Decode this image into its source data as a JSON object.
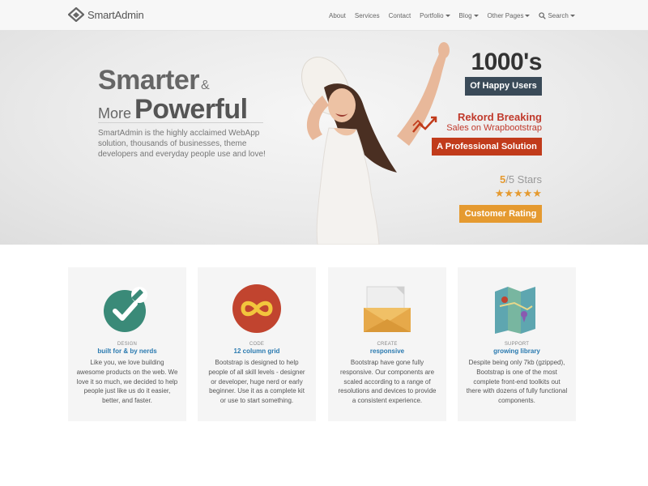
{
  "brand": {
    "name": "SmartAdmin"
  },
  "nav": [
    {
      "label": "About",
      "dropdown": false
    },
    {
      "label": "Services",
      "dropdown": false
    },
    {
      "label": "Contact",
      "dropdown": false
    },
    {
      "label": "Portfolio",
      "dropdown": true
    },
    {
      "label": "Blog",
      "dropdown": true
    },
    {
      "label": "Other Pages",
      "dropdown": true
    },
    {
      "label": "Search",
      "dropdown": true,
      "icon": "search-icon"
    }
  ],
  "hero": {
    "title_word1": "Smarter",
    "title_amp": "&",
    "title_more": "More",
    "title_word2": "Powerful",
    "description": "SmartAdmin is the highly acclaimed WebApp solution, thousands of businesses, theme developers and everyday people use and love!",
    "stat_number": "1000's",
    "stat_badge": "Of Happy Users",
    "trend_icon": "line-chart-icon",
    "rekord_title": "Rekord Breaking",
    "rekord_sub": "Sales on Wrapbootstrap",
    "pro_badge": "A Professional Solution",
    "stars_value": "5",
    "stars_suffix": "/5 Stars",
    "stars_glyphs": "★★★★★",
    "rating_badge": "Customer Rating",
    "colors": {
      "dark_badge": "#3a4a58",
      "red": "#c13b1b",
      "orange": "#e59a30"
    }
  },
  "features": [
    {
      "icon": "check-pencil-icon",
      "category": "DESIGN",
      "subtitle": "built for & by nerds",
      "description": "Like you, we love building awesome products on the web. We love it so much, we decided to help people just like us do it easier, better, and faster."
    },
    {
      "icon": "infinity-icon",
      "category": "CODE",
      "subtitle": "12 column grid",
      "description": "Bootstrap is designed to help people of all skill levels - designer or developer, huge nerd or early beginner. Use it as a complete kit or use to start something."
    },
    {
      "icon": "envelope-icon",
      "category": "CREATE",
      "subtitle": "responsive",
      "description": "Bootstrap have gone fully responsive. Our components are scaled according to a range of resolutions and devices to provide a consistent experience."
    },
    {
      "icon": "map-icon",
      "category": "SUPPORT",
      "subtitle": "growing library",
      "description": "Despite being only 7kb (gzipped), Bootstrap is one of the most complete front-end toolkits out there with dozens of fully functional components."
    }
  ]
}
